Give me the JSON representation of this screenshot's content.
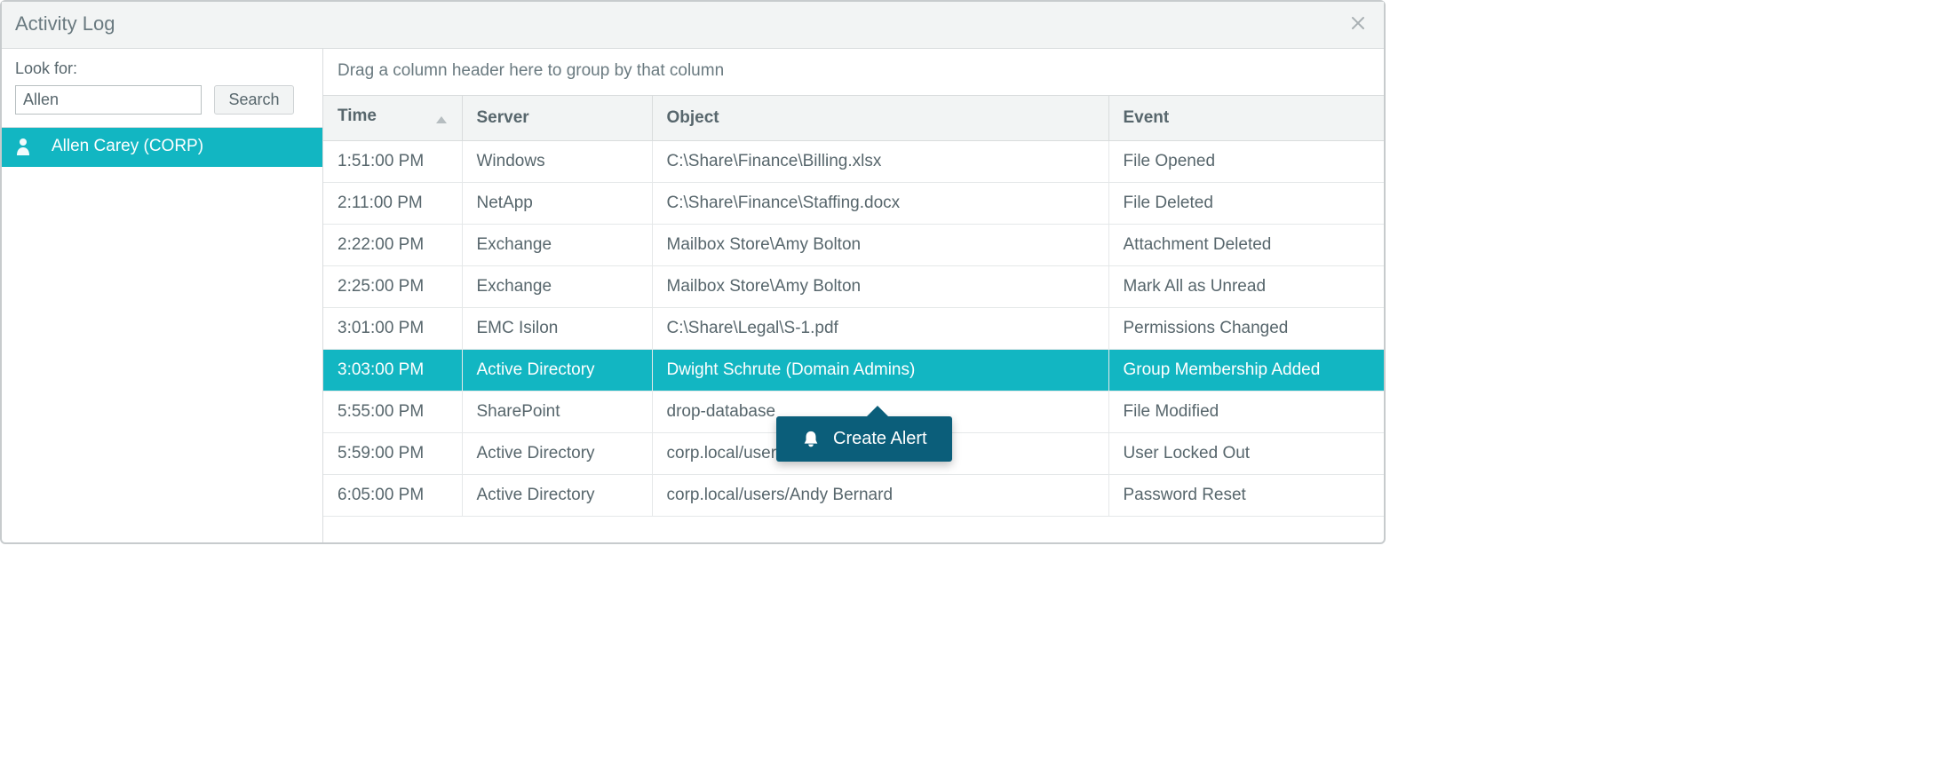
{
  "window": {
    "title": "Activity Log"
  },
  "sidebar": {
    "look_for_label": "Look for:",
    "search_value": "Allen",
    "search_button": "Search",
    "user": "Allen Carey (CORP)"
  },
  "main": {
    "group_hint": "Drag a column header here to group by that column",
    "columns": {
      "time": "Time",
      "server": "Server",
      "object": "Object",
      "event": "Event"
    },
    "rows": [
      {
        "time": "1:51:00 PM",
        "server": "Windows",
        "object": "C:\\Share\\Finance\\Billing.xlsx",
        "event": "File Opened",
        "selected": false
      },
      {
        "time": "2:11:00 PM",
        "server": "NetApp",
        "object": "C:\\Share\\Finance\\Staffing.docx",
        "event": "File Deleted",
        "selected": false
      },
      {
        "time": "2:22:00 PM",
        "server": "Exchange",
        "object": "Mailbox Store\\Amy Bolton",
        "event": "Attachment Deleted",
        "selected": false
      },
      {
        "time": "2:25:00 PM",
        "server": "Exchange",
        "object": "Mailbox Store\\Amy Bolton",
        "event": "Mark All as Unread",
        "selected": false
      },
      {
        "time": "3:01:00 PM",
        "server": "EMC Isilon",
        "object": "C:\\Share\\Legal\\S-1.pdf",
        "event": "Permissions Changed",
        "selected": false
      },
      {
        "time": "3:03:00 PM",
        "server": "Active Directory",
        "object": "Dwight Schrute (Domain Admins)",
        "event": "Group Membership Added",
        "selected": true
      },
      {
        "time": "5:55:00 PM",
        "server": "SharePoint",
        "object": "drop-database",
        "event": "File Modified",
        "selected": false
      },
      {
        "time": "5:59:00 PM",
        "server": "Active Directory",
        "object": "corp.local/users/Andy Bernard",
        "event": "User Locked Out",
        "selected": false
      },
      {
        "time": "6:05:00 PM",
        "server": "Active Directory",
        "object": "corp.local/users/Andy Bernard",
        "event": "Password Reset",
        "selected": false
      }
    ],
    "tooltip_label": "Create Alert"
  }
}
